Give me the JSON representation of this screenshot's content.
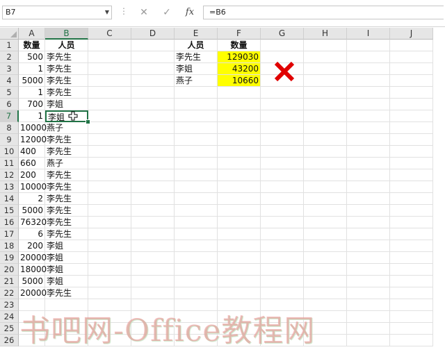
{
  "formula_bar": {
    "name_box": "B7",
    "formula": "=B6"
  },
  "columns": [
    "A",
    "B",
    "C",
    "D",
    "E",
    "F",
    "G",
    "H",
    "I",
    "J"
  ],
  "rows": [
    "1",
    "2",
    "3",
    "4",
    "5",
    "6",
    "7",
    "8",
    "9",
    "10",
    "11",
    "12",
    "13",
    "14",
    "15",
    "16",
    "17",
    "18",
    "19",
    "20",
    "21",
    "22",
    "23",
    "24",
    "25",
    "26"
  ],
  "cells": {
    "A1": "数量",
    "B1": "人员",
    "A2": "500",
    "B2": "李先生",
    "A3": "1",
    "B3": "李先生",
    "A4": "5000",
    "B4": "李先生",
    "A5": "1",
    "B5": "李先生",
    "A6": "700",
    "B6": "李姐",
    "A7": "1",
    "B7": "李姐",
    "A8": "10000",
    "B8": "燕子",
    "A9": "12000",
    "B9": "李先生",
    "A10": "400",
    "B10": "李先生",
    "A11": "660",
    "B11": "燕子",
    "A12": "200",
    "B12": "李先生",
    "A13": "10000",
    "B13": "李先生",
    "A14": "2",
    "B14": "李先生",
    "A15": "5000",
    "B15": "李先生",
    "A16": "76320",
    "B16": "李先生",
    "A17": "6",
    "B17": "李先生",
    "A18": "200",
    "B18": "李姐",
    "A19": "20000",
    "B19": "李姐",
    "A20": "18000",
    "B20": "李姐",
    "A21": "5000",
    "B21": "李姐",
    "A22": "20000",
    "B22": "李先生",
    "E1": "人员",
    "F1": "数量",
    "E2": "李先生",
    "F2": "129030",
    "E3": "李姐",
    "F3": "43200",
    "E4": "燕子",
    "F4": "10660"
  },
  "watermark": "书吧网-Office教程网",
  "colors": {
    "selection": "#217346",
    "highlight": "#ffff00",
    "mark": "#e00000"
  },
  "icons": {
    "cancel": "close-icon",
    "confirm": "check-icon",
    "function": "fx-icon",
    "mark": "red-x-icon"
  }
}
